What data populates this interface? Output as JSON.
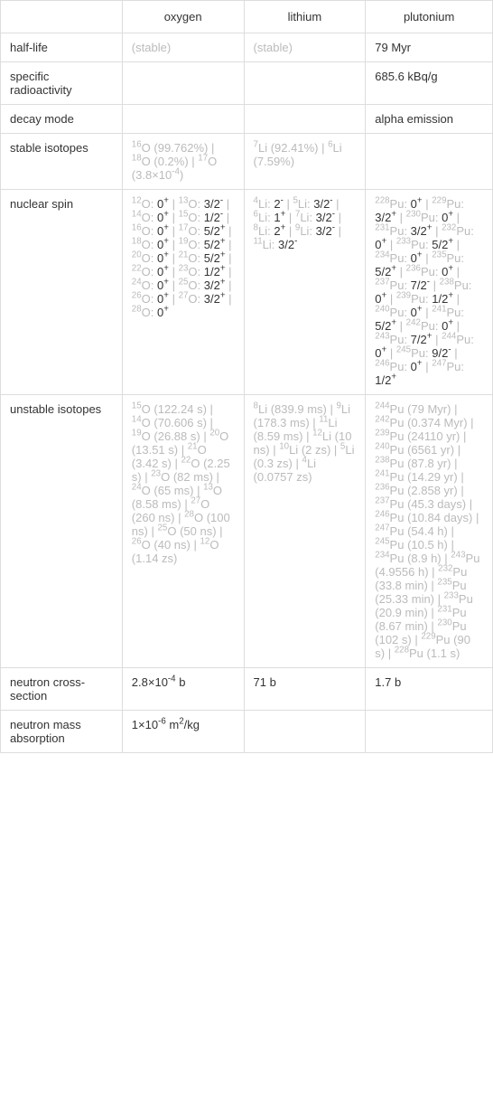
{
  "headers": {
    "empty": "",
    "oxygen": "oxygen",
    "lithium": "lithium",
    "plutonium": "plutonium"
  },
  "rows": {
    "half_life": {
      "label": "half-life",
      "oxygen": "(stable)",
      "lithium": "(stable)",
      "plutonium": "79 Myr"
    },
    "specific_radioactivity": {
      "label": "specific radioactivity",
      "oxygen": "",
      "lithium": "",
      "plutonium": "685.6 kBq/g"
    },
    "decay_mode": {
      "label": "decay mode",
      "oxygen": "",
      "lithium": "",
      "plutonium": "alpha emission"
    },
    "stable_isotopes": {
      "label": "stable isotopes",
      "oxygen_html": "<sup>16</sup>O <span class='muted'>(99.762%)</span> | <sup>18</sup>O <span class='muted'>(0.2%)</span> | <sup>17</sup>O <span class='muted'>(3.8×10<sup>-4</sup>)</span>",
      "lithium_html": "<sup>7</sup>Li <span class='muted'>(92.41%)</span> | <sup>6</sup>Li <span class='muted'>(7.59%)</span>",
      "plutonium": ""
    },
    "nuclear_spin": {
      "label": "nuclear spin",
      "oxygen_html": "<span class='muted'><sup>12</sup>O:</span> 0<sup>+</sup> <span class='muted'>| <sup>13</sup>O:</span> 3/2<sup>-</sup> <span class='muted'>| <sup>14</sup>O:</span> 0<sup>+</sup> <span class='muted'>| <sup>15</sup>O:</span> 1/2<sup>-</sup> <span class='muted'>| <sup>16</sup>O:</span> 0<sup>+</sup> <span class='muted'>| <sup>17</sup>O:</span> 5/2<sup>+</sup> <span class='muted'>| <sup>18</sup>O:</span> 0<sup>+</sup> <span class='muted'>| <sup>19</sup>O:</span> 5/2<sup>+</sup> <span class='muted'>| <sup>20</sup>O:</span> 0<sup>+</sup> <span class='muted'>| <sup>21</sup>O:</span> 5/2<sup>+</sup> <span class='muted'>| <sup>22</sup>O:</span> 0<sup>+</sup> <span class='muted'>| <sup>23</sup>O:</span> 1/2<sup>+</sup> <span class='muted'>| <sup>24</sup>O:</span> 0<sup>+</sup> <span class='muted'>| <sup>25</sup>O:</span> 3/2<sup>+</sup> <span class='muted'>| <sup>26</sup>O:</span> 0<sup>+</sup> <span class='muted'>| <sup>27</sup>O:</span> 3/2<sup>+</sup> <span class='muted'>| <sup>28</sup>O:</span> 0<sup>+</sup>",
      "lithium_html": "<span class='muted'><sup>4</sup>Li:</span> 2<sup>-</sup> <span class='muted'>| <sup>5</sup>Li:</span> 3/2<sup>-</sup> <span class='muted'>| <sup>6</sup>Li:</span> 1<sup>+</sup> <span class='muted'>| <sup>7</sup>Li:</span> 3/2<sup>-</sup> <span class='muted'>| <sup>8</sup>Li:</span> 2<sup>+</sup> <span class='muted'>| <sup>9</sup>Li:</span> 3/2<sup>-</sup> <span class='muted'>| <sup>11</sup>Li:</span> 3/2<sup>-</sup>",
      "plutonium_html": "<span class='muted'><sup>228</sup>Pu:</span> 0<sup>+</sup> <span class='muted'>| <sup>229</sup>Pu:</span> 3/2<sup>+</sup> <span class='muted'>| <sup>230</sup>Pu:</span> 0<sup>+</sup> <span class='muted'>| <sup>231</sup>Pu:</span> 3/2<sup>+</sup> <span class='muted'>| <sup>232</sup>Pu:</span> 0<sup>+</sup> <span class='muted'>| <sup>233</sup>Pu:</span> 5/2<sup>+</sup> <span class='muted'>| <sup>234</sup>Pu:</span> 0<sup>+</sup> <span class='muted'>| <sup>235</sup>Pu:</span> 5/2<sup>+</sup> <span class='muted'>| <sup>236</sup>Pu:</span> 0<sup>+</sup> <span class='muted'>| <sup>237</sup>Pu:</span> 7/2<sup>-</sup> <span class='muted'>| <sup>238</sup>Pu:</span> 0<sup>+</sup> <span class='muted'>| <sup>239</sup>Pu:</span> 1/2<sup>+</sup> <span class='muted'>| <sup>240</sup>Pu:</span> 0<sup>+</sup> <span class='muted'>| <sup>241</sup>Pu:</span> 5/2<sup>+</sup> <span class='muted'>| <sup>242</sup>Pu:</span> 0<sup>+</sup> <span class='muted'>| <sup>243</sup>Pu:</span> 7/2<sup>+</sup> <span class='muted'>| <sup>244</sup>Pu:</span> 0<sup>+</sup> <span class='muted'>| <sup>245</sup>Pu:</span> 9/2<sup>-</sup> <span class='muted'>| <sup>246</sup>Pu:</span> 0<sup>+</sup> <span class='muted'>| <sup>247</sup>Pu:</span> 1/2<sup>+</sup>"
    },
    "unstable_isotopes": {
      "label": "unstable isotopes",
      "oxygen_html": "<sup>15</sup>O <span class='muted'>(122.24 s)</span> | <sup>14</sup>O <span class='muted'>(70.606 s)</span> | <sup>19</sup>O <span class='muted'>(26.88 s)</span> | <sup>20</sup>O <span class='muted'>(13.51 s)</span> | <sup>21</sup>O <span class='muted'>(3.42 s)</span> | <sup>22</sup>O <span class='muted'>(2.25 s)</span> | <sup>23</sup>O <span class='muted'>(82 ms)</span> | <sup>24</sup>O <span class='muted'>(65 ms)</span> | <sup>13</sup>O <span class='muted'>(8.58 ms)</span> | <sup>27</sup>O <span class='muted'>(260 ns)</span> | <sup>28</sup>O <span class='muted'>(100 ns)</span> | <sup>25</sup>O <span class='muted'>(50 ns)</span> | <sup>26</sup>O <span class='muted'>(40 ns)</span> | <sup>12</sup>O <span class='muted'>(1.14 zs)</span>",
      "lithium_html": "<sup>8</sup>Li <span class='muted'>(839.9 ms)</span> | <sup>9</sup>Li <span class='muted'>(178.3 ms)</span> | <sup>11</sup>Li <span class='muted'>(8.59 ms)</span> | <sup>12</sup>Li <span class='muted'>(10 ns)</span> | <sup>10</sup>Li <span class='muted'>(2 zs)</span> | <sup>5</sup>Li <span class='muted'>(0.3 zs)</span> | <sup>4</sup>Li <span class='muted'>(0.0757 zs)</span>",
      "plutonium_html": "<sup>244</sup>Pu <span class='muted'>(79 Myr)</span> | <sup>242</sup>Pu <span class='muted'>(0.374 Myr)</span> | <sup>239</sup>Pu <span class='muted'>(24110 yr)</span> | <sup>240</sup>Pu <span class='muted'>(6561 yr)</span> | <sup>238</sup>Pu <span class='muted'>(87.8 yr)</span> | <sup>241</sup>Pu <span class='muted'>(14.29 yr)</span> | <sup>236</sup>Pu <span class='muted'>(2.858 yr)</span> | <sup>237</sup>Pu <span class='muted'>(45.3 days)</span> | <sup>246</sup>Pu <span class='muted'>(10.84 days)</span> | <sup>247</sup>Pu <span class='muted'>(54.4 h)</span> | <sup>245</sup>Pu <span class='muted'>(10.5 h)</span> | <sup>234</sup>Pu <span class='muted'>(8.9 h)</span> | <sup>243</sup>Pu <span class='muted'>(4.9556 h)</span> | <sup>232</sup>Pu <span class='muted'>(33.8 min)</span> | <sup>235</sup>Pu <span class='muted'>(25.33 min)</span> | <sup>233</sup>Pu <span class='muted'>(20.9 min)</span> | <sup>231</sup>Pu <span class='muted'>(8.67 min)</span> | <sup>230</sup>Pu <span class='muted'>(102 s)</span> | <sup>229</sup>Pu <span class='muted'>(90 s)</span> | <sup>228</sup>Pu <span class='muted'>(1.1 s)</span>"
    },
    "neutron_cross_section": {
      "label": "neutron cross-section",
      "oxygen_html": "2.8×10<sup>-4</sup> b",
      "lithium": "71 b",
      "plutonium": "1.7 b"
    },
    "neutron_mass_absorption": {
      "label": "neutron mass absorption",
      "oxygen_html": "1×10<sup>-6</sup> m<sup>2</sup>/kg",
      "lithium": "",
      "plutonium": ""
    }
  }
}
